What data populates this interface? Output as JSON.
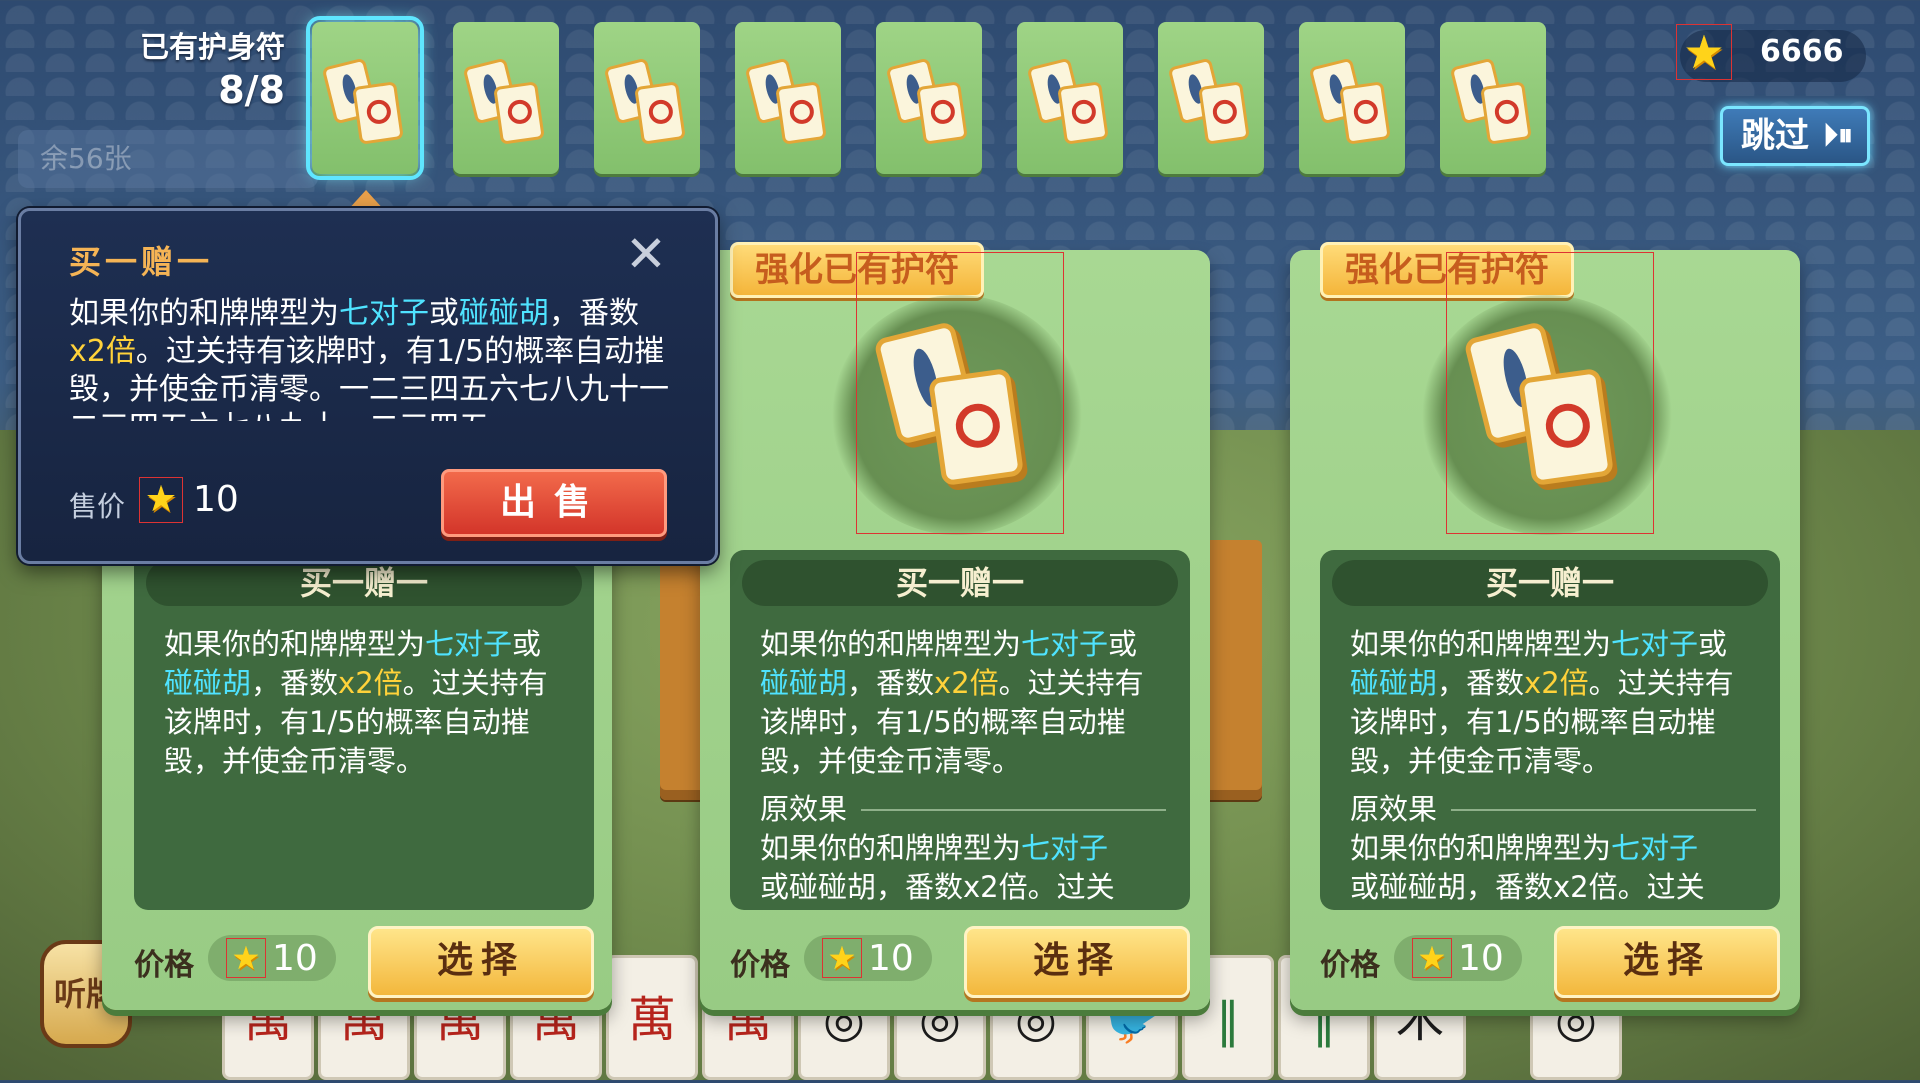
{
  "background": {
    "remaining_label": "余56张",
    "tingpai_label": "听牌",
    "hand_tiles": [
      "萬",
      "萬",
      "萬",
      "萬",
      "萬",
      "萬",
      "◎",
      "◎",
      "◎",
      "🐦",
      "‖",
      "‖",
      "木",
      "◎"
    ]
  },
  "header": {
    "amulet_label": "已有护身符",
    "amulet_count": "8/8",
    "slot_count": 9,
    "coins": "6666",
    "skip_label": "跳过",
    "skip_icon": "fast-forward-icon"
  },
  "popup": {
    "title": "买一赠一",
    "desc_pre": "如果你的和牌牌型为",
    "desc_hl1": "七对子",
    "desc_mid": "或",
    "desc_hl2": "碰碰胡",
    "desc_post1": "，番数",
    "desc_mult": "x2倍",
    "desc_post2": "。过关持有该牌时，有1/5的概率自动摧毁，并使金币清零。一二三四五六七八九十一二三四五六七八九十一二三四五",
    "price_label": "售价",
    "price": "10",
    "sell_label": "出售"
  },
  "cards": [
    {
      "tag": "",
      "name": "买一赠一",
      "desc_pre": "如果你的和牌牌型为",
      "desc_hl1": "七对子",
      "desc_mid": "或",
      "desc_hl2": "碰碰胡",
      "desc_post1": "，番数",
      "desc_mult": "x2倍",
      "desc_post2": "。过关持有该牌时，有1/5的概率自动摧毁，并使金币清零。",
      "price_label": "价格",
      "price": "10",
      "select_label": "选择"
    },
    {
      "tag": "强化已有护符",
      "name": "买一赠一",
      "desc_pre": "如果你的和牌牌型为",
      "desc_hl1": "七对子",
      "desc_mid": "或",
      "desc_hl2": "碰碰胡",
      "desc_post1": "，番数",
      "desc_mult": "x2倍",
      "desc_post2": "。过关持有该牌时，有1/5的概率自动摧毁，并使金币清零。",
      "orig_label": "原效果",
      "orig_pre": "如果你的和牌牌型为",
      "orig_hl1": "七对子",
      "orig_next": "或碰碰胡，番数x2倍。过关",
      "price_label": "价格",
      "price": "10",
      "select_label": "选择"
    },
    {
      "tag": "强化已有护符",
      "name": "买一赠一",
      "desc_pre": "如果你的和牌牌型为",
      "desc_hl1": "七对子",
      "desc_mid": "或",
      "desc_hl2": "碰碰胡",
      "desc_post1": "，番数",
      "desc_mult": "x2倍",
      "desc_post2": "。过关持有该牌时，有1/5的概率自动摧毁，并使金币清零。",
      "orig_label": "原效果",
      "orig_pre": "如果你的和牌牌型为",
      "orig_hl1": "七对子",
      "orig_next": "或碰碰胡，番数x2倍。过关",
      "price_label": "价格",
      "price": "10",
      "select_label": "选择"
    }
  ],
  "colors": {
    "highlight_cyan": "#4fe3ff",
    "highlight_yellow": "#ffd23a",
    "card_green": "#a8d893",
    "select_gold": "#f3b73c",
    "sell_red": "#d3352a"
  }
}
